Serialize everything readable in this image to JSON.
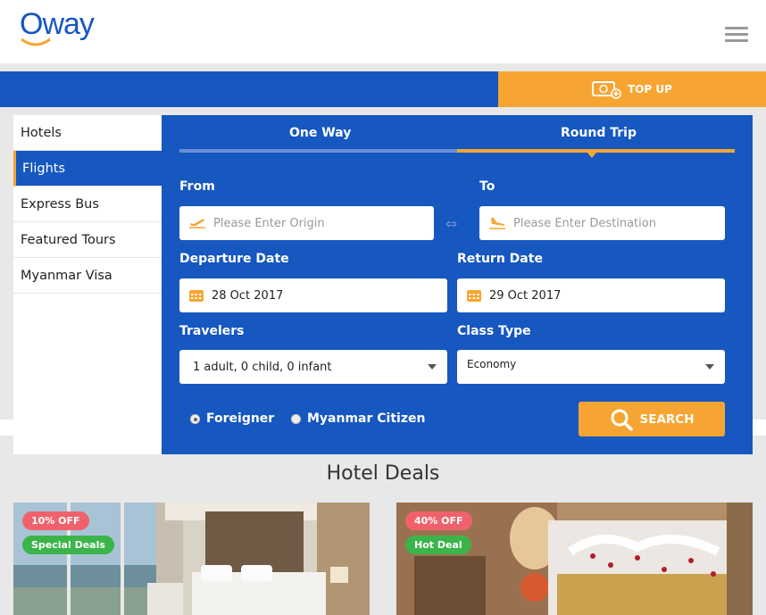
{
  "header": {
    "logo": "Oway"
  },
  "topup": {
    "label": "TOP UP"
  },
  "sidebar": {
    "items": [
      {
        "label": "Hotels"
      },
      {
        "label": "Flights"
      },
      {
        "label": "Express Bus"
      },
      {
        "label": "Featured Tours"
      },
      {
        "label": "Myanmar Visa"
      }
    ]
  },
  "form": {
    "tabs": {
      "one_way": "One Way",
      "round_trip": "Round Trip"
    },
    "from_label": "From",
    "to_label": "To",
    "origin_placeholder": "Please Enter Origin",
    "destination_placeholder": "Please Enter Destination",
    "departure_label": "Departure Date",
    "departure_value": "28 Oct 2017",
    "return_label": "Return Date",
    "return_value": "29 Oct 2017",
    "travelers_label": "Travelers",
    "travelers_value": "1 adult, 0 child, 0 infant",
    "class_label": "Class Type",
    "class_value": "Economy",
    "radio_foreigner": "Foreigner",
    "radio_citizen": "Myanmar Citizen",
    "search_label": "SEARCH"
  },
  "deals": {
    "title": "Hotel Deals",
    "cards": [
      {
        "discount": "10% OFF",
        "tag": "Special Deals"
      },
      {
        "discount": "40% OFF",
        "tag": "Hot Deal"
      }
    ]
  },
  "colors": {
    "primary": "#1657c0",
    "accent": "#f7a532",
    "discount": "#f0626b",
    "tag": "#3bb44a"
  }
}
